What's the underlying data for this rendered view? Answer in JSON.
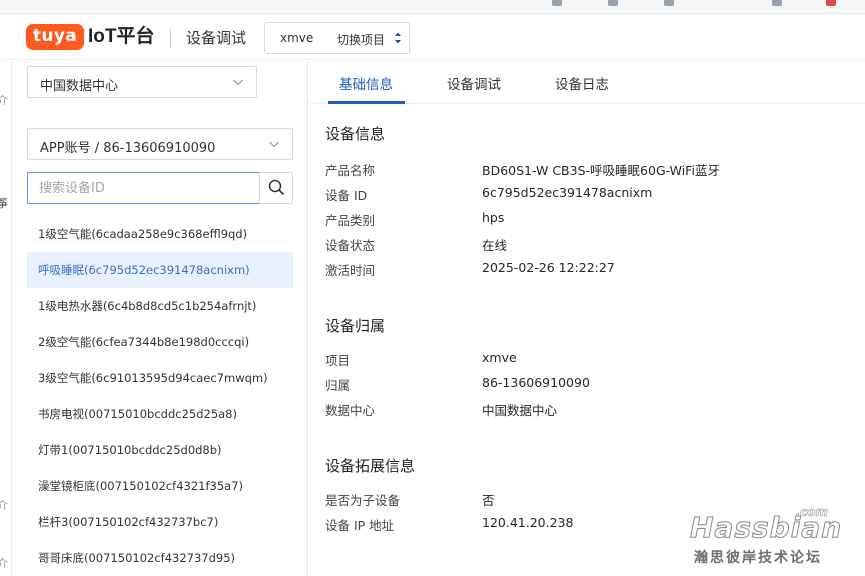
{
  "header": {
    "logo_text": "tuya",
    "platform": "IoT平台",
    "page_title": "设备调试",
    "project_name": "xmve",
    "switch_label": "切换项目",
    "brand_color": "#ff5a1f"
  },
  "left": {
    "datacenter": "中国数据中心",
    "account": "APP账号 / 86-13606910090",
    "search_placeholder": "搜索设备ID",
    "devices": [
      {
        "label": "1级空气能(6cadaa258e9c368effl9qd)"
      },
      {
        "label": "呼吸睡眠(6c795d52ec391478acnixm)"
      },
      {
        "label": "1级电热水器(6c4b8d8cd5c1b254afrnjt)"
      },
      {
        "label": "2级空气能(6cfea7344b8e198d0cccqi)"
      },
      {
        "label": "3级空气能(6c91013595d94caec7mwqm)"
      },
      {
        "label": "书房电视(00715010bcddc25d25a8)"
      },
      {
        "label": "灯带1(00715010bcddc25d0d8b)"
      },
      {
        "label": "澡堂镜柜底(007150102cf4321f35a7)"
      },
      {
        "label": "栏杆3(007150102cf432737bc7)"
      },
      {
        "label": "哥哥床底(007150102cf432737d95)"
      }
    ],
    "active_index": 1
  },
  "tabs": [
    "基础信息",
    "设备调试",
    "设备日志"
  ],
  "device_info": {
    "title": "设备信息",
    "rows": [
      {
        "k": "产品名称",
        "v": "BD60S1-W CB3S-呼吸睡眠60G-WiFi蓝牙"
      },
      {
        "k": "设备 ID",
        "v": "6c795d52ec391478acnixm"
      },
      {
        "k": "产品类别",
        "v": "hps"
      },
      {
        "k": "设备状态",
        "v": "在线"
      },
      {
        "k": "激活时间",
        "v": "2025-02-26 12:22:27"
      }
    ]
  },
  "ownership": {
    "title": "设备归属",
    "rows": [
      {
        "k": "项目",
        "v": "xmve"
      },
      {
        "k": "归属",
        "v": "86-13606910090"
      },
      {
        "k": "数据中心",
        "v": "中国数据中心"
      }
    ]
  },
  "extended": {
    "title": "设备拓展信息",
    "rows": [
      {
        "k": "是否为子设备",
        "v": "否"
      },
      {
        "k": "设备 IP 地址",
        "v": "120.41.20.238"
      }
    ]
  },
  "watermark": {
    "name": "Hassbian",
    "domain": ".com",
    "cn": "瀚思彼岸技术论坛"
  }
}
